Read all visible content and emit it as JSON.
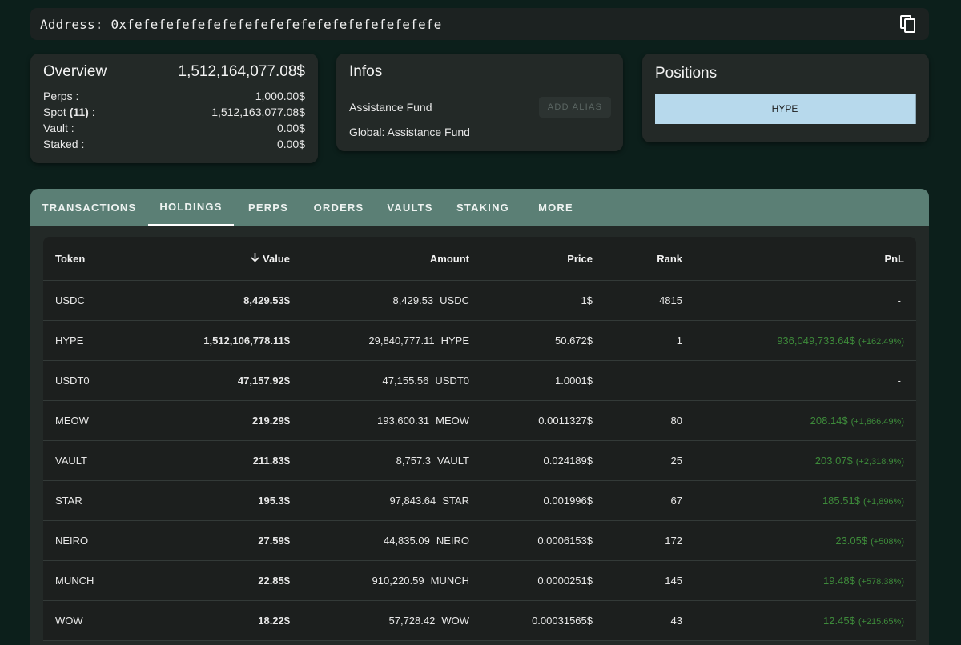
{
  "address": {
    "label": "Address: 0xfefefefefefefefefefefefefefefefefefefefe"
  },
  "overview": {
    "title": "Overview",
    "total": "1,512,164,077.08$",
    "rows": [
      {
        "label": "Perps :",
        "value": "1,000.00$"
      },
      {
        "label_prefix": "Spot ",
        "label_bold": "(11)",
        "label_suffix": " :",
        "value": "1,512,163,077.08$"
      },
      {
        "label": "Vault :",
        "value": "0.00$"
      },
      {
        "label": "Staked :",
        "value": "0.00$"
      }
    ]
  },
  "infos": {
    "title": "Infos",
    "name": "Assistance Fund",
    "add_alias": "ADD ALIAS",
    "global": "Global: Assistance Fund"
  },
  "positions": {
    "title": "Positions",
    "chip": "HYPE"
  },
  "tabs": [
    "TRANSACTIONS",
    "HOLDINGS",
    "PERPS",
    "ORDERS",
    "VAULTS",
    "STAKING",
    "MORE"
  ],
  "table": {
    "headers": {
      "token": "Token",
      "value": "Value",
      "amount": "Amount",
      "price": "Price",
      "rank": "Rank",
      "pnl": "PnL"
    },
    "rows": [
      {
        "token": "USDC",
        "value": "8,429.53$",
        "amount": "8,429.53",
        "amount_sym": "USDC",
        "price": "1$",
        "rank": "4815",
        "pnl": "-",
        "pnl_pct": ""
      },
      {
        "token": "HYPE",
        "value": "1,512,106,778.11$",
        "amount": "29,840,777.11",
        "amount_sym": "HYPE",
        "price": "50.672$",
        "rank": "1",
        "pnl": "936,049,733.64$",
        "pnl_pct": "(+162.49%)"
      },
      {
        "token": "USDT0",
        "value": "47,157.92$",
        "amount": "47,155.56",
        "amount_sym": "USDT0",
        "price": "1.0001$",
        "rank": "",
        "pnl": "-",
        "pnl_pct": ""
      },
      {
        "token": "MEOW",
        "value": "219.29$",
        "amount": "193,600.31",
        "amount_sym": "MEOW",
        "price": "0.0011327$",
        "rank": "80",
        "pnl": "208.14$",
        "pnl_pct": "(+1,866.49%)"
      },
      {
        "token": "VAULT",
        "value": "211.83$",
        "amount": "8,757.3",
        "amount_sym": "VAULT",
        "price": "0.024189$",
        "rank": "25",
        "pnl": "203.07$",
        "pnl_pct": "(+2,318.9%)"
      },
      {
        "token": "STAR",
        "value": "195.3$",
        "amount": "97,843.64",
        "amount_sym": "STAR",
        "price": "0.001996$",
        "rank": "67",
        "pnl": "185.51$",
        "pnl_pct": "(+1,896%)"
      },
      {
        "token": "NEIRO",
        "value": "27.59$",
        "amount": "44,835.09",
        "amount_sym": "NEIRO",
        "price": "0.0006153$",
        "rank": "172",
        "pnl": "23.05$",
        "pnl_pct": "(+508%)"
      },
      {
        "token": "MUNCH",
        "value": "22.85$",
        "amount": "910,220.59",
        "amount_sym": "MUNCH",
        "price": "0.0000251$",
        "rank": "145",
        "pnl": "19.48$",
        "pnl_pct": "(+578.38%)"
      },
      {
        "token": "WOW",
        "value": "18.22$",
        "amount": "57,728.42",
        "amount_sym": "WOW",
        "price": "0.00031565$",
        "rank": "43",
        "pnl": "12.45$",
        "pnl_pct": "(+215.65%)"
      }
    ]
  },
  "colors": {
    "background": "#0c1f1b",
    "card": "#232927",
    "tab_bar": "#5b7f75",
    "pnl_positive": "#3d8a3a",
    "position_chip": "#b7d9ec"
  },
  "icons": {
    "copy": "copy-icon",
    "sort": "arrow-down-icon"
  }
}
